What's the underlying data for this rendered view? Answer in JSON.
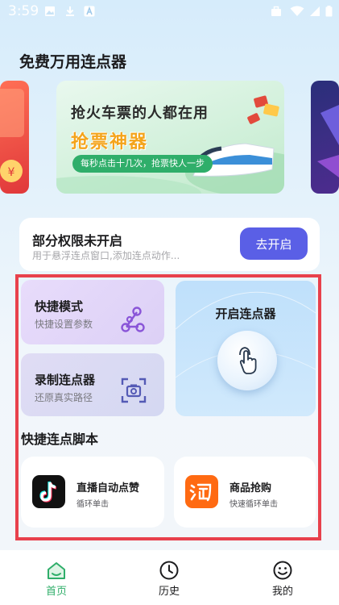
{
  "status_bar": {
    "time": "3:59"
  },
  "header": {
    "title": "免费万用连点器"
  },
  "banner": {
    "headline": "抢火车票的人都在用",
    "brand": "抢票神器",
    "pill": "每秒点击十几次，抢票快人一步"
  },
  "permission": {
    "title": "部分权限未开启",
    "subtitle": "用于悬浮连点窗口,添加连点动作...",
    "button": "去开启"
  },
  "features": {
    "quick": {
      "title": "快捷模式",
      "subtitle": "快捷设置参数",
      "icon": "nodes-icon"
    },
    "record": {
      "title": "录制连点器",
      "subtitle": "还原真实路径",
      "icon": "camera-scan-icon"
    },
    "start": {
      "title": "开启连点器",
      "icon": "tap-hand-icon"
    }
  },
  "scripts": {
    "section_title": "快捷连点脚本",
    "items": [
      {
        "title": "直播自动点赞",
        "subtitle": "循环单击",
        "icon": "tiktok-icon",
        "icon_color": "#111111"
      },
      {
        "title": "商品抢购",
        "subtitle": "快速循环单击",
        "icon": "taobao-icon",
        "icon_color": "#ff6a12"
      }
    ]
  },
  "nav": {
    "items": [
      {
        "label": "首页",
        "icon": "home-icon",
        "active": true
      },
      {
        "label": "历史",
        "icon": "clock-icon",
        "active": false
      },
      {
        "label": "我的",
        "icon": "smiley-icon",
        "active": false
      }
    ]
  },
  "colors": {
    "accent": "#5a5fe6",
    "active_nav": "#2fae6a",
    "highlight_frame": "#e8414c"
  }
}
